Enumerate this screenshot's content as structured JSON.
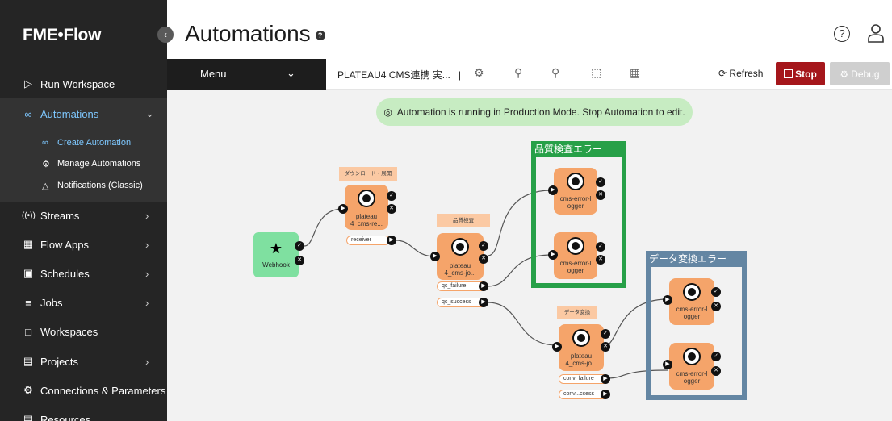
{
  "sidebar": {
    "logo": "FME•Flow",
    "items": [
      {
        "label": "Run Workspace"
      },
      {
        "label": "Automations"
      },
      {
        "label": "Streams"
      },
      {
        "label": "Flow Apps"
      },
      {
        "label": "Schedules"
      },
      {
        "label": "Jobs"
      },
      {
        "label": "Workspaces"
      },
      {
        "label": "Projects"
      },
      {
        "label": "Connections & Parameters"
      },
      {
        "label": "Resources"
      }
    ],
    "sub_items": [
      {
        "label": "Create Automation"
      },
      {
        "label": "Manage Automations"
      },
      {
        "label": "Notifications (Classic)"
      }
    ]
  },
  "header": {
    "title": "Automations"
  },
  "toolbar": {
    "menu_label": "Menu",
    "workspace_name": "PLATEAU4 CMS連携 実...",
    "separator": "|",
    "refresh_label": "Refresh",
    "stop_label": "Stop",
    "debug_label": "Debug"
  },
  "banner": {
    "text": "Automation is running in Production Mode. Stop Automation to edit."
  },
  "canvas": {
    "webhook": {
      "label": "Webhook"
    },
    "nodes": [
      {
        "header": "ダウンロード・展開",
        "line1": "plateau",
        "line2": "4_cms-re...",
        "port": "receiver"
      },
      {
        "header": "品質検査",
        "line1": "plateau",
        "line2": "4_cms-jo...",
        "port": "qc_failure",
        "port2": "qc_success"
      },
      {
        "header": "データ変換",
        "line1": "plateau",
        "line2": "4_cms-jo...",
        "port": "conv_failure",
        "port2": "conv...ccess"
      }
    ],
    "logger": {
      "line1": "cms-error-l",
      "line2": "ogger"
    },
    "groups": [
      {
        "title": "品質検査エラー",
        "color": "#27a048"
      },
      {
        "title": "データ変換エラー",
        "color": "#6486a3"
      }
    ]
  }
}
